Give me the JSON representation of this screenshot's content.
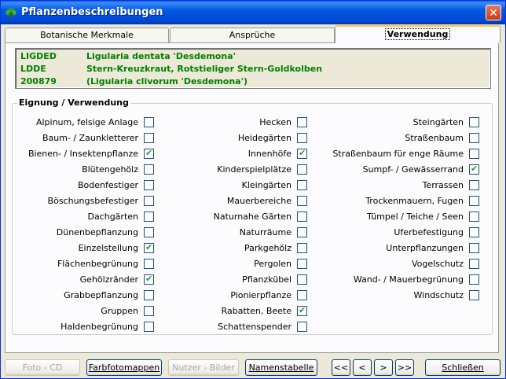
{
  "window": {
    "title": "Pflanzenbeschreibungen",
    "close_glyph": "✕"
  },
  "tabs": [
    {
      "label": "Botanische Merkmale",
      "active": false
    },
    {
      "label": "Ansprüche",
      "active": false
    },
    {
      "label": "Verwendung",
      "active": true
    }
  ],
  "plant": [
    {
      "code": "LIGDED",
      "desc": "Ligularia dentata 'Desdemona'"
    },
    {
      "code": "LDDE",
      "desc": "Stern-Kreuzkraut, Rotstieliger Stern-Goldkolben"
    },
    {
      "code": "200879",
      "desc": "(Ligularia clivorum 'Desdemona')"
    }
  ],
  "group": {
    "label": "Eignung / Verwendung",
    "columns": [
      [
        {
          "label": "Alpinum, felsige Anlage",
          "checked": false
        },
        {
          "label": "Baum- / Zaunkletterer",
          "checked": false
        },
        {
          "label": "Bienen- / Insektenpflanze",
          "checked": true
        },
        {
          "label": "Blütengehölz",
          "checked": false
        },
        {
          "label": "Bodenfestiger",
          "checked": false
        },
        {
          "label": "Böschungsbefestiger",
          "checked": false
        },
        {
          "label": "Dachgärten",
          "checked": false
        },
        {
          "label": "Dünenbepflanzung",
          "checked": false
        },
        {
          "label": "Einzelstellung",
          "checked": true
        },
        {
          "label": "Flächenbegrünung",
          "checked": false
        },
        {
          "label": "Gehölzränder",
          "checked": true
        },
        {
          "label": "Grabbepflanzung",
          "checked": false
        },
        {
          "label": "Gruppen",
          "checked": false
        },
        {
          "label": "Haldenbegrünung",
          "checked": false
        }
      ],
      [
        {
          "label": "Hecken",
          "checked": false
        },
        {
          "label": "Heidegärten",
          "checked": false
        },
        {
          "label": "Innenhöfe",
          "checked": true
        },
        {
          "label": "Kinderspielplätze",
          "checked": false
        },
        {
          "label": "Kleingärten",
          "checked": false
        },
        {
          "label": "Mauerbereiche",
          "checked": false
        },
        {
          "label": "Naturnahe Gärten",
          "checked": false
        },
        {
          "label": "Naturräume",
          "checked": false
        },
        {
          "label": "Parkgehölz",
          "checked": false
        },
        {
          "label": "Pergolen",
          "checked": false
        },
        {
          "label": "Pflanzkübel",
          "checked": false
        },
        {
          "label": "Pionierpflanze",
          "checked": false
        },
        {
          "label": "Rabatten, Beete",
          "checked": true
        },
        {
          "label": "Schattenspender",
          "checked": false
        }
      ],
      [
        {
          "label": "Steingärten",
          "checked": false
        },
        {
          "label": "Straßenbaum",
          "checked": false
        },
        {
          "label": "Straßenbaum für enge Räume",
          "checked": false
        },
        {
          "label": "Sumpf- / Gewässerrand",
          "checked": true
        },
        {
          "label": "Terrassen",
          "checked": false
        },
        {
          "label": "Trockenmauern, Fugen",
          "checked": false
        },
        {
          "label": "Tümpel / Teiche / Seen",
          "checked": false
        },
        {
          "label": "Uferbefestigung",
          "checked": false
        },
        {
          "label": "Unterpflanzungen",
          "checked": false
        },
        {
          "label": "Vogelschutz",
          "checked": false
        },
        {
          "label": "Wand- / Mauerbegrünung",
          "checked": false
        },
        {
          "label": "Windschutz",
          "checked": false
        }
      ]
    ]
  },
  "footer": {
    "photo_cd": "Foto - CD",
    "farbfoto": "Farbfotomappen",
    "nutzer": "Nutzer - Bilder",
    "namen": "Namenstabelle",
    "first": "<<",
    "prev": "<",
    "next": ">",
    "last": ">>",
    "close": "Schließen"
  },
  "colors": {
    "accent_green": "#008000",
    "title_blue": "#0054e3",
    "check_green": "#21a121"
  }
}
